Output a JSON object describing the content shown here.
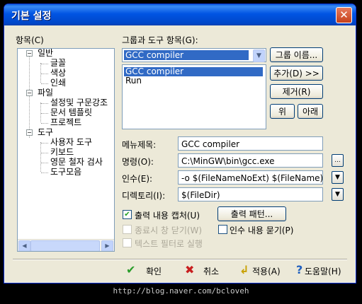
{
  "window": {
    "title": "기본 설정",
    "close_label": "✕"
  },
  "tree": {
    "label": "항목(C)",
    "items": [
      {
        "label": "일반",
        "expander": "−"
      },
      {
        "label": "글꼴"
      },
      {
        "label": "색상"
      },
      {
        "label": "인쇄"
      },
      {
        "label": "파일",
        "expander": "−"
      },
      {
        "label": "설정및 구문강조"
      },
      {
        "label": "문서 템플릿"
      },
      {
        "label": "프로젝트"
      },
      {
        "label": "도구",
        "expander": "−"
      },
      {
        "label": "사용자 도구"
      },
      {
        "label": "키보드"
      },
      {
        "label": "영문 철자 검사"
      },
      {
        "label": "도구모음"
      }
    ],
    "scroll_left": "◀",
    "scroll_right": "▶"
  },
  "group": {
    "label": "그룹과 도구 항목(G):",
    "combo_value": "GCC compiler",
    "combo_arrow": "▼",
    "list_items": [
      "GCC compiler",
      "Run"
    ],
    "rename_button": "그룹 이름...",
    "add_button": "추가(D) >>",
    "remove_button": "제거(R)",
    "up_button": "위",
    "down_button": "아래"
  },
  "form": {
    "menu_title_label": "메뉴제목:",
    "menu_title_value": "GCC compiler",
    "command_label": "명령(O):",
    "command_value": "C:\\MinGW\\bin\\gcc.exe",
    "browse_button": "...",
    "args_label": "인수(E):",
    "args_value": "-o $(FileNameNoExt) $(FileName)",
    "dir_label": "디렉토리(I):",
    "dir_value": "$(FileDir)",
    "dropdown_arrow": "▼"
  },
  "options": {
    "capture_output": "출력 내용 캡처(U)",
    "capture_checked": "✔",
    "output_pattern_button": "출력 패턴...",
    "close_on_exit": "종료시 창 닫기(W)",
    "ask_args": "인수 내용 묻기(P)",
    "text_filter": "텍스트 필터로 실행"
  },
  "buttons": {
    "ok": "확인",
    "ok_icon": "✔",
    "cancel": "취소",
    "cancel_icon": "✖",
    "apply": "적용(A)",
    "apply_icon": "↲",
    "help": "도움말(H)",
    "help_icon": "?"
  },
  "footer": {
    "url": "http://blog.naver.com/bcloveh"
  },
  "colors": {
    "accent": "#316ac5",
    "titlebar": "#0054e3",
    "ok_icon": "#2a9d2a",
    "cancel_icon": "#c81e1e"
  }
}
